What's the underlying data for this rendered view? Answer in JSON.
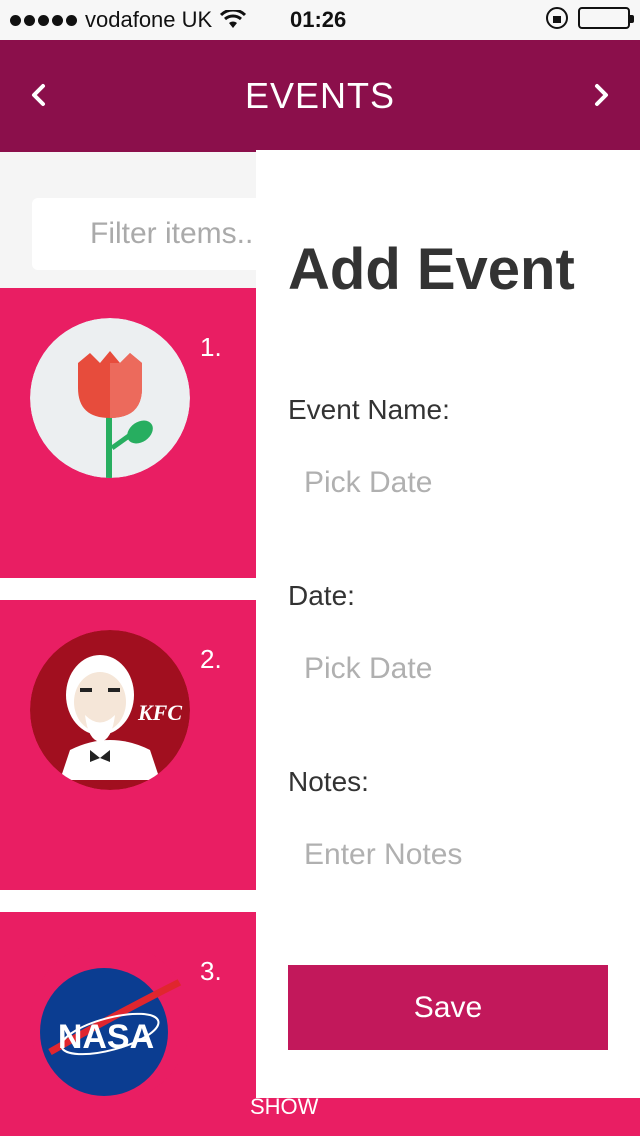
{
  "status_bar": {
    "carrier": "vodafone UK",
    "time": "01:26"
  },
  "header": {
    "title": "EVENTS",
    "prev_icon": "chevron-left-icon",
    "next_icon": "chevron-right-icon"
  },
  "filter": {
    "placeholder": "Filter items..."
  },
  "events": [
    {
      "number": "1.",
      "logo": "tulip-logo"
    },
    {
      "number": "2.",
      "logo": "kfc-logo",
      "logo_text": "KFC"
    },
    {
      "number": "3.",
      "logo": "nasa-logo",
      "logo_text": "NASA",
      "visible_text": "SHOW"
    }
  ],
  "add_event": {
    "title": "Add Event",
    "event_name_label": "Event Name:",
    "event_name_placeholder": "Pick Date",
    "date_label": "Date:",
    "date_placeholder": "Pick Date",
    "notes_label": "Notes:",
    "notes_placeholder": "Enter Notes",
    "save_label": "Save"
  },
  "colors": {
    "header": "#8b0f4b",
    "card": "#e91e63",
    "save_button": "#c2185b"
  }
}
